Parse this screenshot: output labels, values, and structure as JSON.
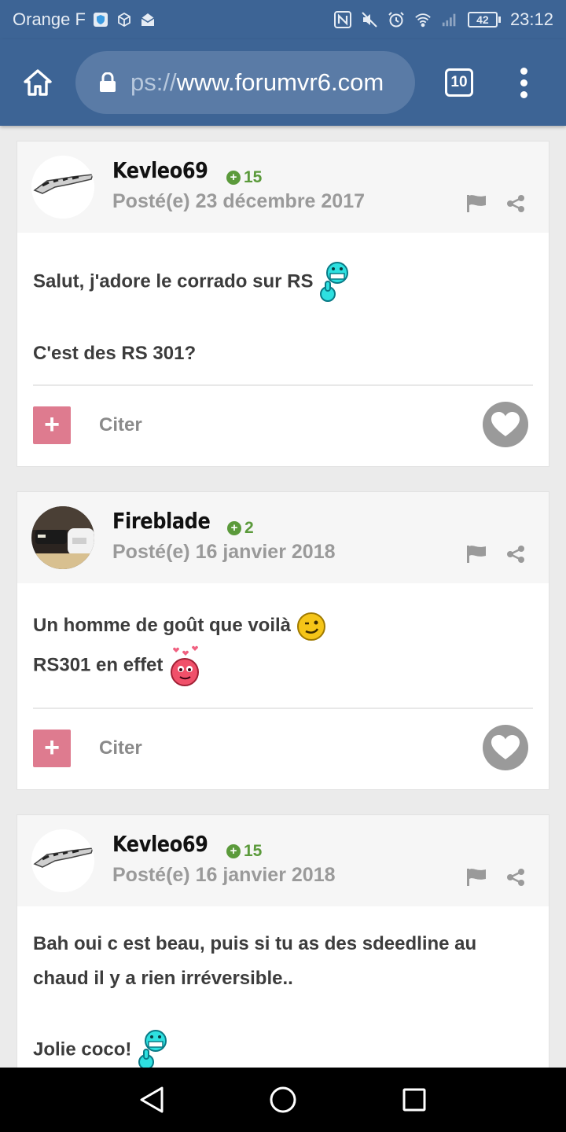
{
  "status_bar": {
    "carrier": "Orange F",
    "battery": "42",
    "time": "23:12"
  },
  "browser": {
    "url_scheme": "ps://",
    "url_host": "www.forumvr6.com",
    "tab_count": "10"
  },
  "posts": [
    {
      "author": "Kevleo69",
      "reputation": "15",
      "date": "Posté(e) 23 décembre 2017",
      "lines": [
        "Salut, j'adore le corrado sur RS",
        "C'est des RS 301?"
      ],
      "quote_label": "Citer"
    },
    {
      "author": "Fireblade",
      "reputation": "2",
      "date": "Posté(e) 16 janvier 2018",
      "lines": [
        "Un homme de goût que voilà",
        "RS301 en effet"
      ],
      "quote_label": "Citer"
    },
    {
      "author": "Kevleo69",
      "reputation": "15",
      "date": "Posté(e) 16 janvier 2018",
      "lines": [
        "Bah oui c est beau, puis si tu as des sdeedline au",
        "chaud il y a rien irréversible..",
        "Jolie coco!"
      ]
    }
  ],
  "colors": {
    "header": "#3d6495",
    "url_bar": "#5a7ba6",
    "reputation": "#5b9a3b",
    "add_button": "#de7b8f"
  }
}
